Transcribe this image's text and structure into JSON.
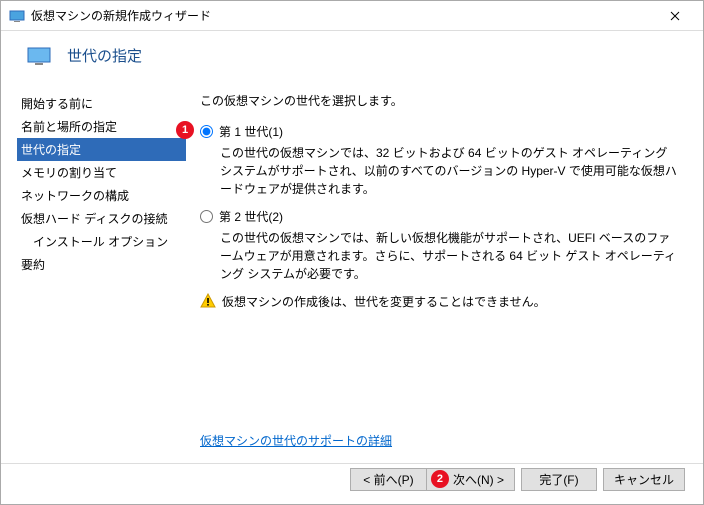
{
  "window": {
    "title": "仮想マシンの新規作成ウィザード",
    "close": "×"
  },
  "header": {
    "title": "世代の指定"
  },
  "sidebar": {
    "items": [
      {
        "label": "開始する前に"
      },
      {
        "label": "名前と場所の指定"
      },
      {
        "label": "世代の指定"
      },
      {
        "label": "メモリの割り当て"
      },
      {
        "label": "ネットワークの構成"
      },
      {
        "label": "仮想ハード ディスクの接続"
      },
      {
        "label": "インストール オプション"
      },
      {
        "label": "要約"
      }
    ]
  },
  "main": {
    "instruction": "この仮想マシンの世代を選択します。",
    "gen1": {
      "label": "第 1 世代(1)",
      "desc": "この世代の仮想マシンでは、32 ビットおよび 64 ビットのゲスト オペレーティング システムがサポートされ、以前のすべてのバージョンの Hyper-V で使用可能な仮想ハードウェアが提供されます。"
    },
    "gen2": {
      "label": "第 2 世代(2)",
      "desc": "この世代の仮想マシンでは、新しい仮想化機能がサポートされ、UEFI ベースのファームウェアが用意されます。さらに、サポートされる 64 ビット ゲスト オペレーティング システムが必要です。"
    },
    "warning": "仮想マシンの作成後は、世代を変更することはできません。",
    "link": "仮想マシンの世代のサポートの詳細"
  },
  "footer": {
    "prev": "< 前へ(P)",
    "next": "次へ(N) >",
    "finish": "完了(F)",
    "cancel": "キャンセル"
  },
  "annotations": {
    "badge1": "1",
    "badge2": "2"
  }
}
